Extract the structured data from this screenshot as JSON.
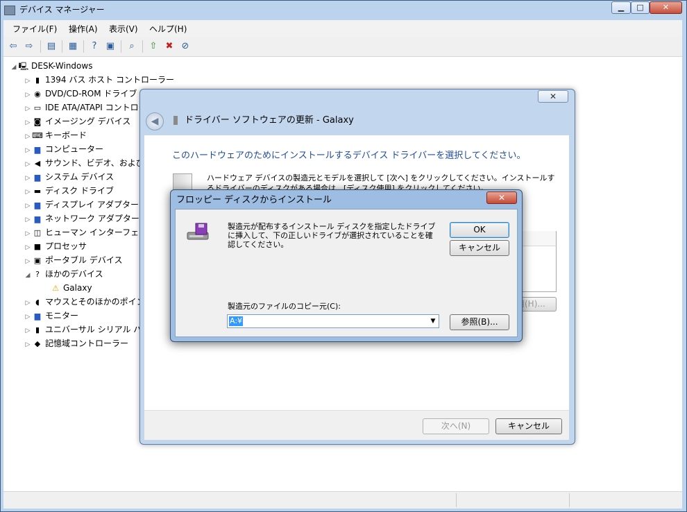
{
  "main_window": {
    "title": "デバイス マネージャー",
    "caption_buttons": {
      "minimize": "▁",
      "maximize": "□",
      "close": "✕"
    }
  },
  "menu": [
    "ファイル(F)",
    "操作(A)",
    "表示(V)",
    "ヘルプ(H)"
  ],
  "toolbar": [
    "back-icon",
    "forward-icon",
    "show-hide-console-tree-icon",
    "properties-icon",
    "help-icon",
    "view-icon",
    "scan-hardware-icon",
    "update-driver-icon",
    "uninstall-icon",
    "disable-icon"
  ],
  "tree": {
    "root": "DESK-Windows",
    "items": [
      "1394 バス ホスト コントローラー",
      "DVD/CD-ROM ドライブ",
      "IDE ATA/ATAPI コントローラー",
      "イメージング デバイス",
      "キーボード",
      "コンピューター",
      "サウンド、ビデオ、および",
      "システム デバイス",
      "ディスク ドライブ",
      "ディスプレイ アダプター",
      "ネットワーク アダプター",
      "ヒューマン インターフェイス",
      "プロセッサ",
      "ポータブル デバイス",
      "ほかのデバイス",
      "Galaxy",
      "マウスとそのほかのポインティング",
      "モニター",
      "ユニバーサル シリアル バス",
      "記憶域コントローラー"
    ]
  },
  "wizard": {
    "title": "ドライバー ソフトウェアの更新 - Galaxy",
    "close": "✕",
    "heading": "このハードウェアのためにインストールするデバイス ドライバーを選択してください。",
    "description": "ハードウェア デバイスの製造元とモデルを選択して [次へ] をクリックしてください。インストールするドライバーのディスクがある場合は、[ディスク使用] をクリックしてください。",
    "have_disk_partial": "用(H)...",
    "next_button": "次へ(N)",
    "cancel_button": "キャンセル"
  },
  "floppy_dialog": {
    "title": "フロッピー ディスクからインストール",
    "close": "✕",
    "message": "製造元が配布するインストール ディスクを指定したドライブに挿入して、下の正しいドライブが選択されていることを確認してください。",
    "ok_button": "OK",
    "cancel_button": "キャンセル",
    "copy_from_label": "製造元のファイルのコピー元(C):",
    "copy_from_value": "A:¥",
    "browse_button": "参照(B)..."
  }
}
